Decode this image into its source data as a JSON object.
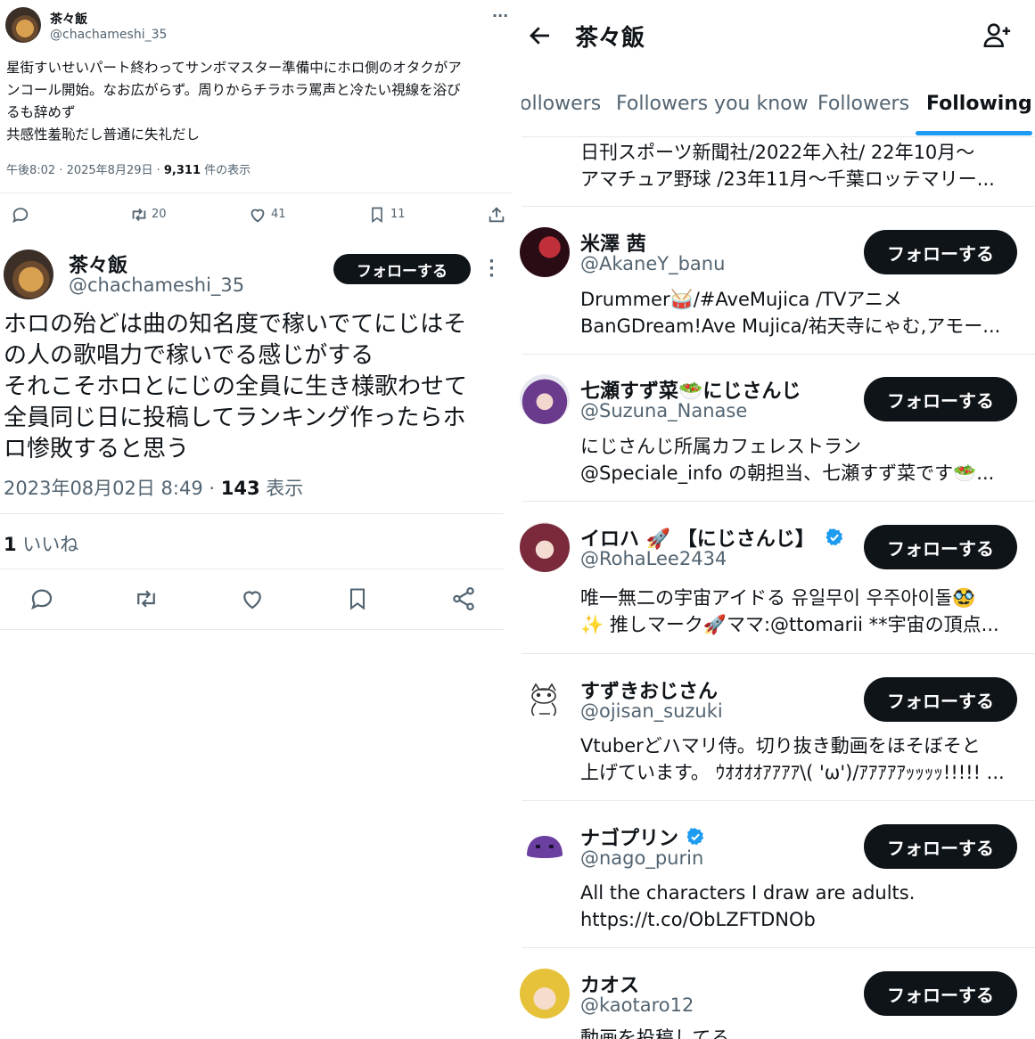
{
  "tweet1": {
    "name": "茶々飯",
    "handle": "@chachameshi_35",
    "more": "···",
    "text_lines": [
      "星街すいせいパート終わってサンボマスター準備中にホロ側のオタクがア",
      "ンコール開始。なお広がらず。周りからチラホラ罵声と冷たい視線を浴び",
      "るも辞めず",
      "共感性羞恥だし普通に失礼だし"
    ],
    "meta_time": "午後8:02 · 2025年8月29日 · ",
    "meta_views": "9,311",
    "meta_views_label": " 件の表示",
    "retweets": "20",
    "likes": "41",
    "bookmarks": "11"
  },
  "tweet2": {
    "name": "茶々飯",
    "handle": "@chachameshi_35",
    "follow_label": "フォローする",
    "text_lines": [
      "ホロの殆どは曲の知名度で稼いでてにじはそ",
      "の人の歌唱力で稼いでる感じがする",
      "それこそホロとにじの全員に生き様歌わせて",
      "全員同じ日に投稿してランキング作ったらホ",
      "ロ惨敗すると思う"
    ],
    "date": "2023年08月02日 8:49 · ",
    "views": "143",
    "views_label": " 表示",
    "likes_count": "1",
    "likes_label": " いいね"
  },
  "header": {
    "title": "茶々飯",
    "tabs": [
      "ollowers",
      "Followers you know",
      "Followers",
      "Following"
    ],
    "active_tab": "Following"
  },
  "partial_row": {
    "bio_lines": [
      "日刊スポーツ新聞社/2022年入社/ 22年10月〜",
      "アマチュア野球 /23年11月〜千葉ロッテマリー..."
    ]
  },
  "users": [
    {
      "name": "米澤 茜",
      "handle": "@AkaneY_banu",
      "verified": false,
      "bio_lines": [
        "Drummer🥁/#AveMujica /TVアニメ",
        "BanGDream!Ave Mujica/祐天寺にゃむ,アモー..."
      ]
    },
    {
      "name": "七瀬すず菜🥗にじさんじ",
      "handle": "@Suzuna_Nanase",
      "verified": false,
      "bio_lines": [
        "にじさんじ所属カフェレストラン",
        "@Speciale_info の朝担当、七瀬すず菜です🥗..."
      ]
    },
    {
      "name": "イロハ 🚀 【にじさんじ】",
      "handle": "@RohaLee2434",
      "verified": true,
      "bio_lines": [
        "唯一無二の宇宙アイドる 유일무이 우주아이돌🥸",
        "✨ 推しマーク🚀ママ:@ttomarii **宇宙の頂点..."
      ]
    },
    {
      "name": "すずきおじさん",
      "handle": "@ojisan_suzuki",
      "verified": false,
      "bio_lines": [
        "Vtuberどハマリ侍。切り抜き動画をほそぼそと",
        "上げています。 ｳｵｵｵｵｱｱｱｱ\\( 'ω')/ｱｱｱｱｱｯｯｯｯ!!!!! ..."
      ]
    },
    {
      "name": "ナゴプリン",
      "handle": "@nago_purin",
      "verified": true,
      "bio_lines": [
        "All the characters I draw are adults.",
        "https://t.co/ObLZFTDNOb"
      ]
    },
    {
      "name": "カオス",
      "handle": "@kaotaro12",
      "verified": false,
      "bio_lines": [
        "動画を投稿してる"
      ]
    }
  ],
  "follow_label": "フォローする",
  "colors": {
    "accent": "#1d9bf0",
    "text": "#0f1419",
    "secondary": "#536471",
    "button": "#0f1419"
  }
}
